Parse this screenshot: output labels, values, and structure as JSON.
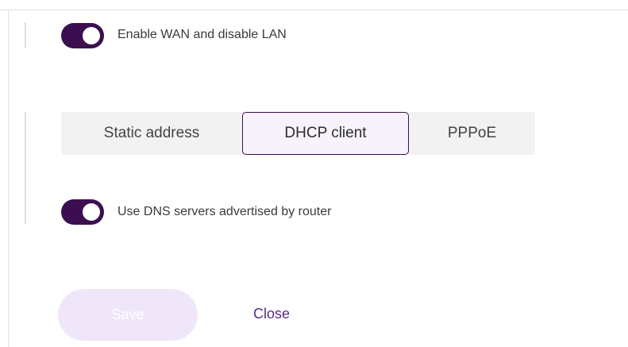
{
  "wan_toggle": {
    "label": "Enable WAN and disable LAN",
    "state": "on"
  },
  "connection_mode": {
    "options": [
      "Static address",
      "DHCP client",
      "PPPoE"
    ],
    "selected": "DHCP client"
  },
  "dns_toggle": {
    "label": "Use DNS servers advertised by router",
    "state": "on"
  },
  "actions": {
    "save_label": "Save",
    "close_label": "Close"
  },
  "colors": {
    "toggle_on": "#3b0f4f",
    "save_disabled": "#efe6f9",
    "link": "#5a2a8a"
  }
}
